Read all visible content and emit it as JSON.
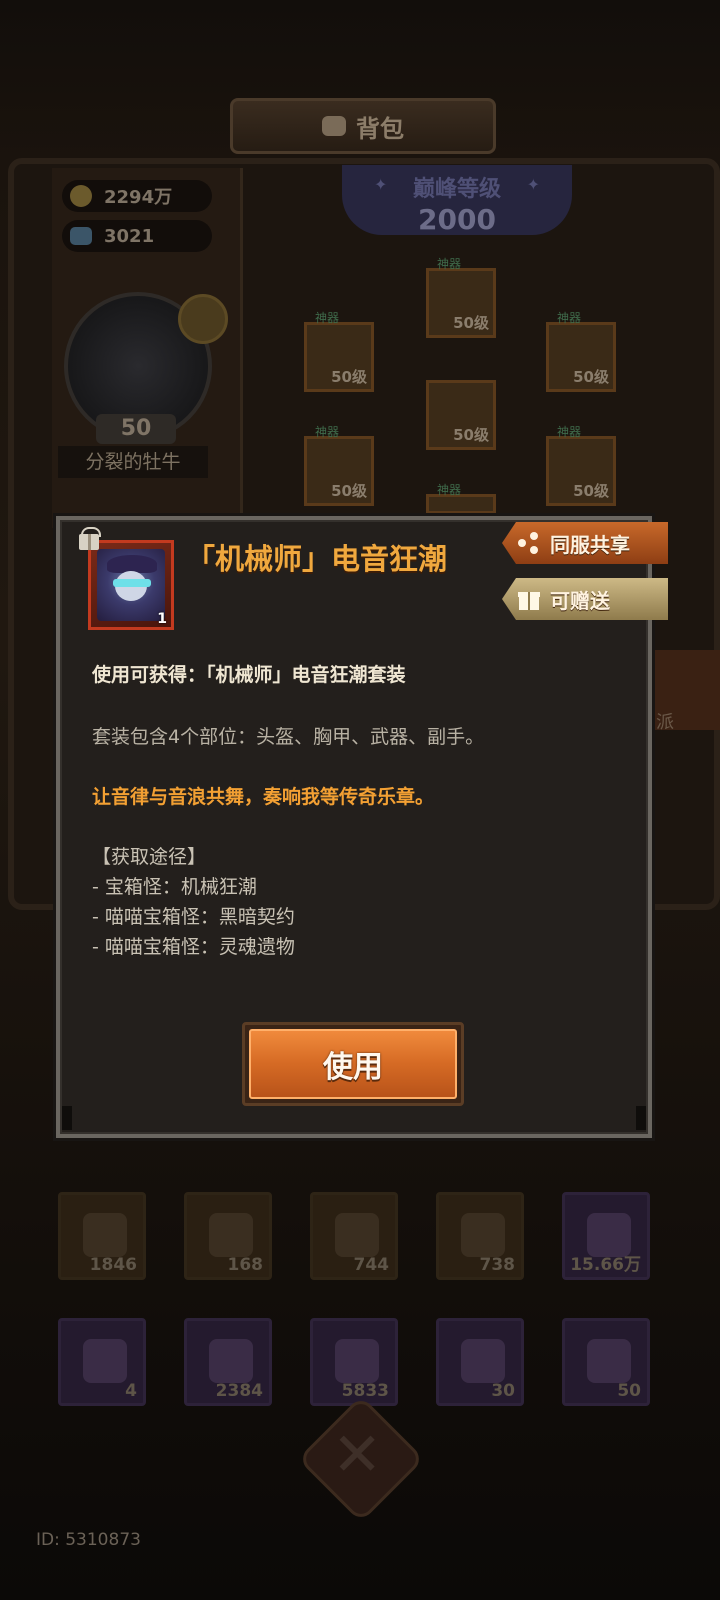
{
  "background": {
    "header_title": "背包",
    "resources": [
      {
        "icon": "gold-coin-icon",
        "value": "2294万"
      },
      {
        "icon": "diamond-icon",
        "value": "3021"
      }
    ],
    "player": {
      "level": "50",
      "name": "分裂的牡牛"
    },
    "peak": {
      "label": "巅峰等级",
      "value": "2000"
    },
    "equipment_slots": [
      {
        "tag": "神器",
        "level": "50级"
      },
      {
        "tag": "神器",
        "level": "50级"
      },
      {
        "tag": "神器",
        "level": "50级"
      },
      {
        "tag": "",
        "level": "50级"
      },
      {
        "tag": "神器",
        "level": "50级"
      },
      {
        "tag": "神器",
        "level": "50级"
      },
      {
        "tag": "神器",
        "level": ""
      }
    ],
    "inventory_row1": [
      {
        "count": "1846",
        "style": "gold"
      },
      {
        "count": "168",
        "style": "gold"
      },
      {
        "count": "744",
        "style": "gold"
      },
      {
        "count": "738",
        "style": "gold"
      },
      {
        "count": "15.66万",
        "style": "purple"
      }
    ],
    "inventory_row2": [
      {
        "count": "4",
        "style": "purple"
      },
      {
        "count": "2384",
        "style": "purple"
      },
      {
        "count": "5833",
        "style": "purple"
      },
      {
        "count": "30",
        "style": "purple"
      },
      {
        "count": "50",
        "style": "purple"
      }
    ],
    "id_text": "ID: 5310873"
  },
  "modal": {
    "title": "「机械师」电音狂潮",
    "item_count": "1",
    "share_button": "同服共享",
    "gift_button": "可赠送",
    "lines": {
      "reward": "使用可获得：「机械师」电音狂潮套装",
      "parts": "套装包含4个部位：头盔、胸甲、武器、副手。",
      "flavor": "让音律与音浪共舞，奏响我等传奇乐章。",
      "source_header": "【获取途径】",
      "sources": [
        "- 宝箱怪：机械狂潮",
        "- 喵喵宝箱怪：黑暗契约",
        "- 喵喵宝箱怪：灵魂遗物"
      ]
    },
    "use_button": "使用"
  },
  "colors": {
    "accent_orange": "#f3a033",
    "title_orange": "#f0a83e",
    "share_button": "#c8692a",
    "gift_button": "#cdb986",
    "use_button": "#d56a24"
  }
}
